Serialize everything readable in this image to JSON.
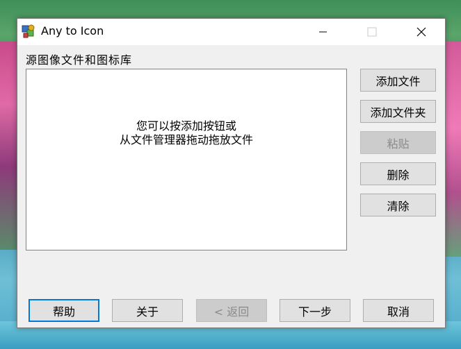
{
  "window": {
    "title": "Any to Icon",
    "minimize_label": "—",
    "maximize_label": "☐",
    "close_label": "✕"
  },
  "source": {
    "label": "源图像文件和图标库",
    "hint_line1": "您可以按添加按钮或",
    "hint_line2": "从文件管理器拖动拖放文件"
  },
  "side_buttons": {
    "add_file": "添加文件",
    "add_folder": "添加文件夹",
    "paste": "粘贴",
    "delete": "删除",
    "clear": "清除"
  },
  "bottom_buttons": {
    "help": "帮助",
    "about": "关于",
    "back": "< 返回",
    "next": "下一步",
    "cancel": "取消"
  },
  "colors": {
    "accent": "#0078d7",
    "window_bg": "#f0f0f0",
    "disabled_bg": "#cccccc"
  }
}
